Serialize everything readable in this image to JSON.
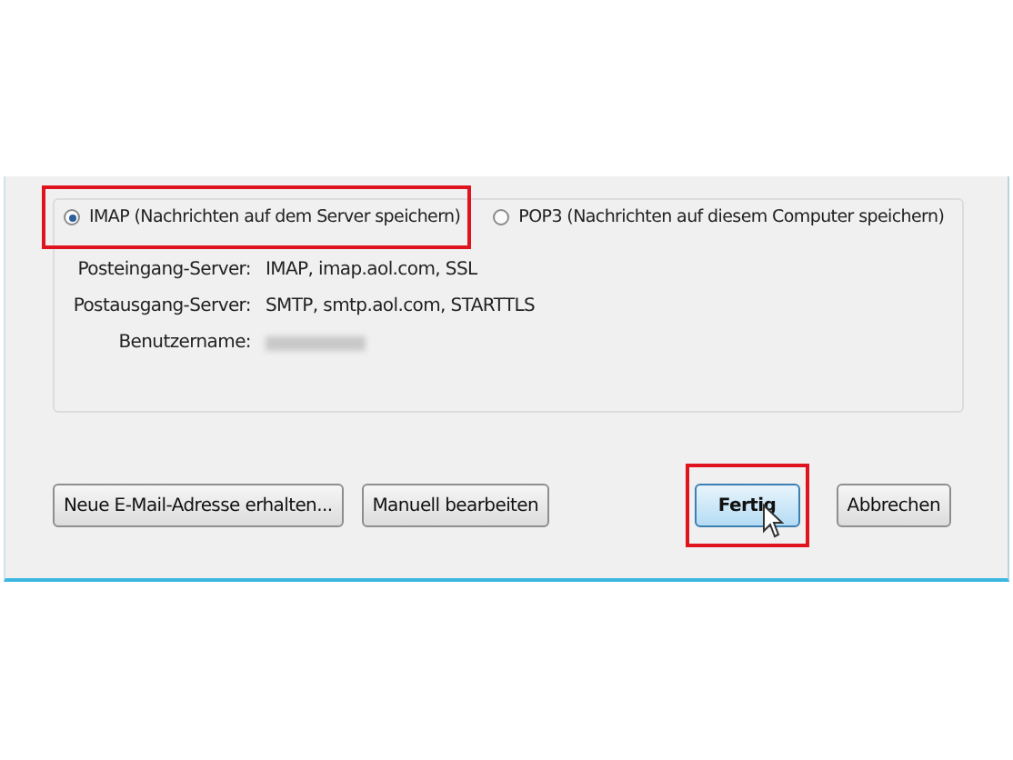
{
  "protocols": [
    {
      "label": "IMAP (Nachrichten auf dem Server speichern)",
      "selected": true,
      "highlighted": true
    },
    {
      "label": "POP3 (Nachrichten auf diesem Computer speichern)",
      "selected": false,
      "highlighted": false
    }
  ],
  "settings": [
    {
      "label": "Posteingang-Server:",
      "value": "IMAP, imap.aol.com, SSL",
      "kind": "text"
    },
    {
      "label": "Postausgang-Server:",
      "value": "SMTP, smtp.aol.com, STARTTLS",
      "kind": "text"
    },
    {
      "label": "Benutzername:",
      "kind": "redacted"
    }
  ],
  "buttons_left": [
    {
      "label": "Neue E-Mail-Adresse erhalten..."
    },
    {
      "label": "Manuell bearbeiten"
    }
  ],
  "buttons_right": [
    {
      "label": "Fertig",
      "default": true,
      "highlighted": true
    },
    {
      "label": "Abbrechen",
      "default": false,
      "highlighted": false
    }
  ]
}
